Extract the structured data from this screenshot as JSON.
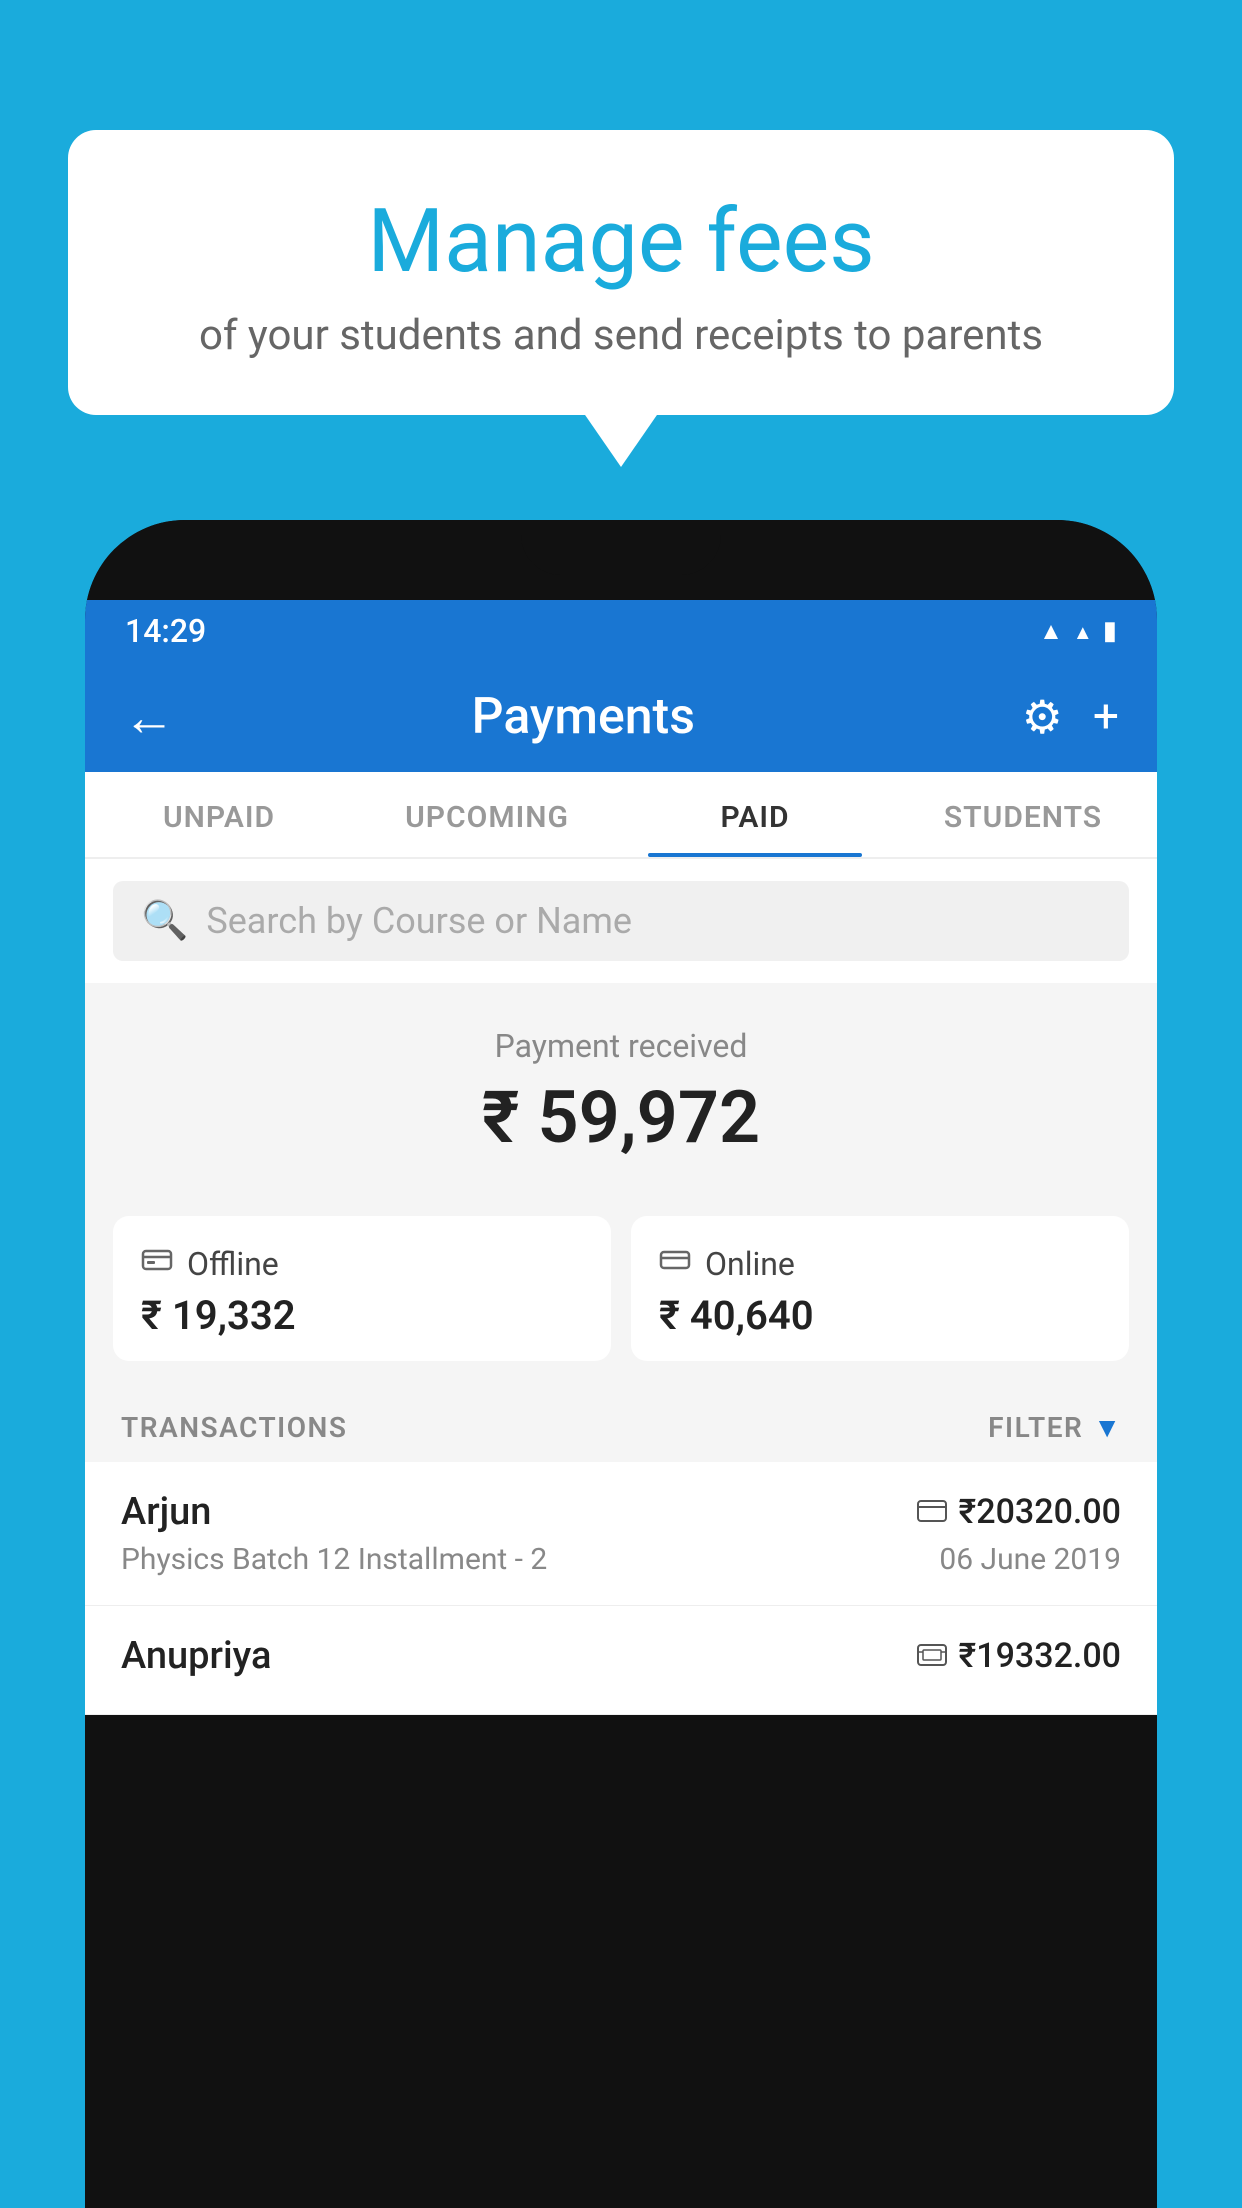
{
  "background_color": "#1AABDC",
  "speech_bubble": {
    "title": "Manage fees",
    "subtitle": "of your students and send receipts to parents"
  },
  "phone": {
    "status_bar": {
      "time": "14:29",
      "icons": [
        "wifi",
        "signal",
        "battery"
      ]
    },
    "header": {
      "back_label": "←",
      "title": "Payments",
      "settings_icon": "⚙",
      "add_icon": "+"
    },
    "tabs": [
      {
        "label": "UNPAID",
        "active": false
      },
      {
        "label": "UPCOMING",
        "active": false
      },
      {
        "label": "PAID",
        "active": true
      },
      {
        "label": "STUDENTS",
        "active": false
      }
    ],
    "search": {
      "placeholder": "Search by Course or Name"
    },
    "payment_summary": {
      "label": "Payment received",
      "amount": "₹ 59,972",
      "offline": {
        "icon": "💳",
        "label": "Offline",
        "amount": "₹ 19,332"
      },
      "online": {
        "icon": "💳",
        "label": "Online",
        "amount": "₹ 40,640"
      }
    },
    "transactions": {
      "header_label": "TRANSACTIONS",
      "filter_label": "FILTER",
      "items": [
        {
          "name": "Arjun",
          "amount": "₹20320.00",
          "payment_method_icon": "card",
          "description": "Physics Batch 12 Installment - 2",
          "date": "06 June 2019"
        },
        {
          "name": "Anupriya",
          "amount": "₹19332.00",
          "payment_method_icon": "cash",
          "description": "",
          "date": ""
        }
      ]
    }
  }
}
